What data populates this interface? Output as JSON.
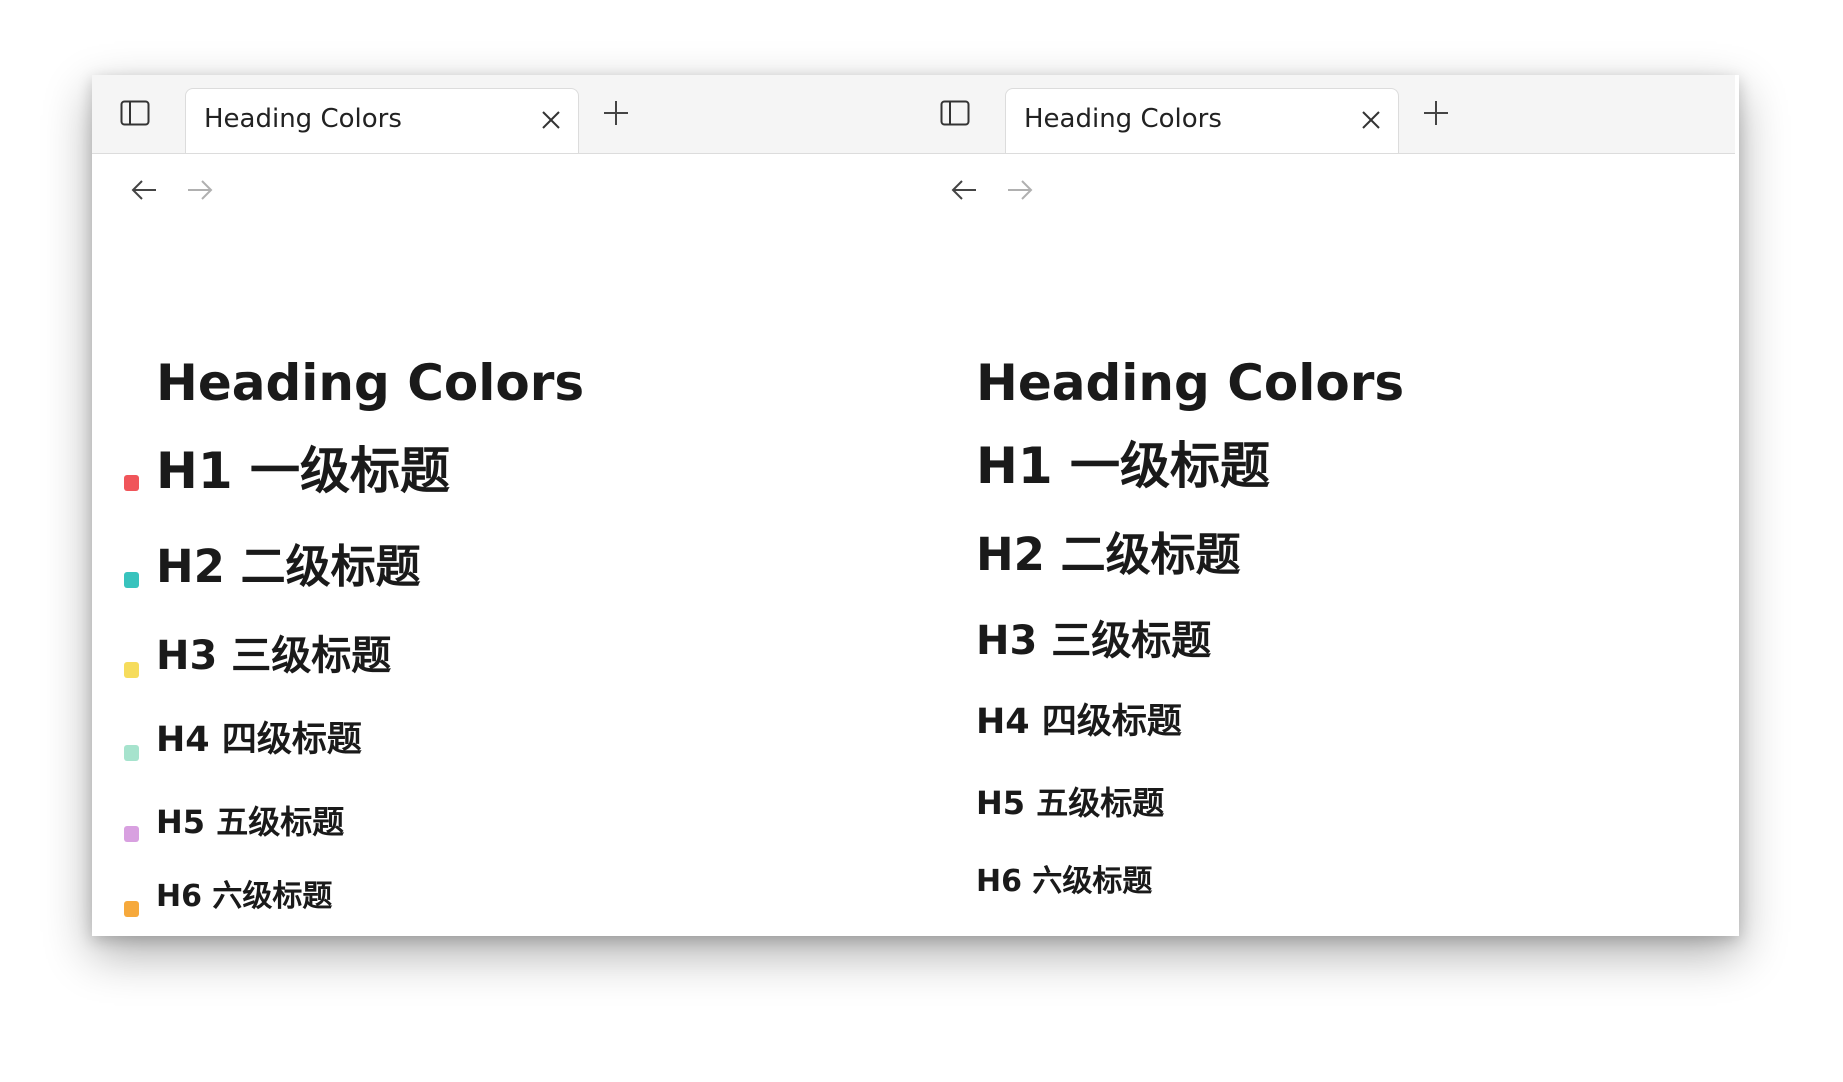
{
  "left_pane": {
    "tab": {
      "title": "Heading Colors"
    },
    "page_title": "Heading Colors",
    "headings": [
      {
        "text": "H1 一级标题",
        "marker_color": "#f0555a"
      },
      {
        "text": "H2 二级标题",
        "marker_color": "#38c3bd"
      },
      {
        "text": "H3 三级标题",
        "marker_color": "#f6dc5c"
      },
      {
        "text": "H4 四级标题",
        "marker_color": "#a6e3cd"
      },
      {
        "text": "H5 五级标题",
        "marker_color": "#d8a0e0"
      },
      {
        "text": "H6 六级标题",
        "marker_color": "#f6a93c"
      }
    ]
  },
  "right_pane": {
    "tab": {
      "title": "Heading Colors"
    },
    "page_title": "Heading Colors",
    "headings": [
      {
        "text": "H1 一级标题"
      },
      {
        "text": "H2 二级标题"
      },
      {
        "text": "H3 三级标题"
      },
      {
        "text": "H4 四级标题"
      },
      {
        "text": "H5 五级标题"
      },
      {
        "text": "H6 六级标题"
      }
    ]
  },
  "icons": {
    "sidebar_toggle": "sidebar-toggle-icon",
    "close": "close-icon",
    "new_tab": "plus-icon",
    "back": "arrow-left-icon",
    "forward": "arrow-right-icon"
  }
}
